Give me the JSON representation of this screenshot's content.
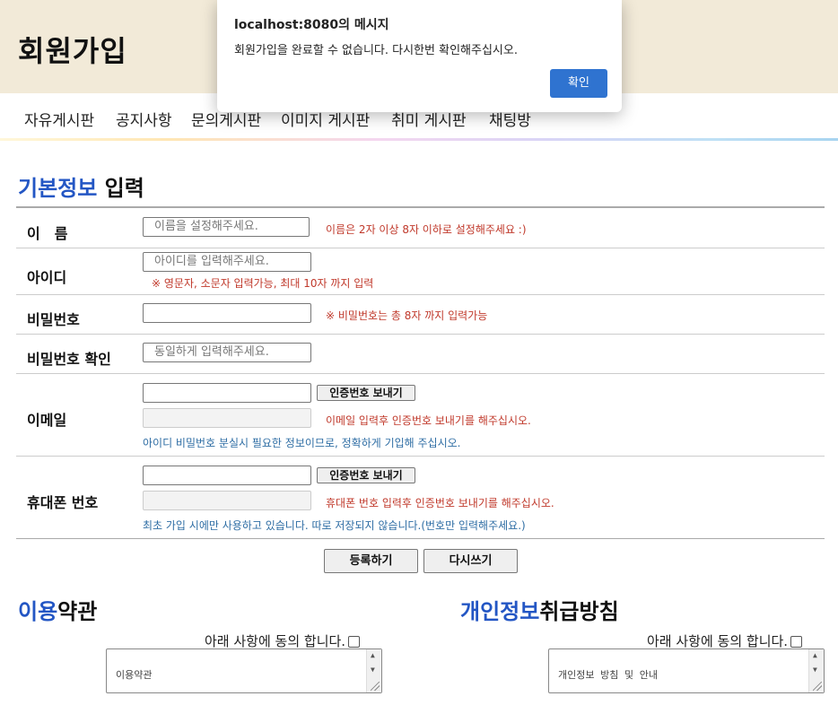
{
  "site": {
    "title": "회원가입",
    "nav": [
      "자유게시판",
      "공지사항",
      "문의게시판",
      "이미지 게시판",
      "취미 게시판",
      "채팅방"
    ]
  },
  "basic_info": {
    "title_accent": "기본정보",
    "title_rest": " 입력",
    "name": {
      "label": "이　름",
      "placeholder": "이름을 설정해주세요.",
      "hint": "이름은 2자 이상 8자 이하로 설정해주세요 :)"
    },
    "id": {
      "label": "아이디",
      "placeholder": "아이디를 입력해주세요.",
      "hint": "※ 영문자, 소문자 입력가능, 최대 10자 까지 입력"
    },
    "password": {
      "label": "비밀번호",
      "placeholder": "",
      "hint": "※ 비밀번호는 총 8자 까지 입력가능"
    },
    "password_confirm": {
      "label": "비밀번호 확인",
      "placeholder": "동일하게 입력해주세요."
    },
    "email": {
      "label": "이메일",
      "send_button": "인증번호 보내기",
      "hint_red": "이메일 입력후 인증번호 보내기를 해주십시오.",
      "hint_blue": "아이디 비밀번호 분실시 필요한 정보이므로, 정확하게 기입해 주십시오."
    },
    "phone": {
      "label": "휴대폰 번호",
      "send_button": "인증번호 보내기",
      "hint_red": "휴대폰 번호 입력후 인증번호 보내기를 해주십시오.",
      "hint_blue": "최초 가입 시에만 사용하고 있습니다. 따로 저장되지 않습니다.(번호만 입력해주세요.)"
    }
  },
  "actions": {
    "register": "등록하기",
    "reset": "다시쓰기"
  },
  "terms": {
    "title_accent": "이용",
    "title_rest": "약관",
    "agree_label": "아래 사항에 동의 합니다.",
    "content": "이용약관"
  },
  "privacy": {
    "title_accent": "개인정보",
    "title_rest": "취급방침",
    "agree_label": "아래 사항에 동의 합니다.",
    "content": "개인정보 방침 및 안내"
  },
  "dialog": {
    "title": "localhost:8080의 메시지",
    "message": "회원가입을 완료할 수 없습니다. 다시한번 확인해주십시오.",
    "ok": "확인"
  },
  "colors": {
    "accent_blue": "#2356c4",
    "hint_red": "#c0392b",
    "hint_blue": "#2e6da4",
    "header_bg": "#f2ead8",
    "dialog_button": "#2f73d0"
  }
}
